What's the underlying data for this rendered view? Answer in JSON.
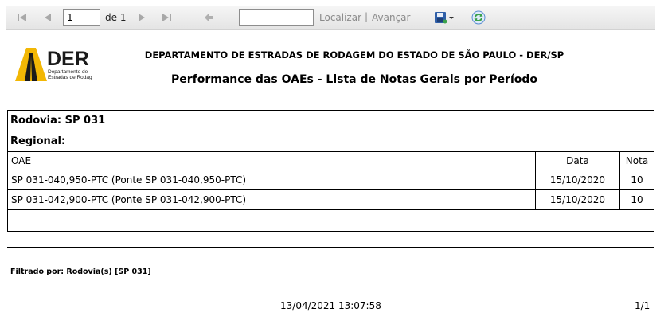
{
  "toolbar": {
    "page_current": "1",
    "page_of": "de 1",
    "find_placeholder": "",
    "find_label": "Localizar",
    "separator": "|",
    "next_label": "Avançar"
  },
  "header": {
    "logo_text": "DER",
    "logo_subtitle_1": "Departamento de",
    "logo_subtitle_2": "Estradas de Rodagem",
    "org_title": "DEPARTAMENTO DE ESTRADAS DE RODAGEM DO ESTADO DE SÃO PAULO - DER/SP",
    "report_title": "Performance das OAEs - Lista de Notas Gerais por Período"
  },
  "table": {
    "rodovia": "Rodovia: SP 031",
    "regional": "Regional:",
    "columns": [
      "OAE",
      "Data",
      "Nota"
    ],
    "rows": [
      {
        "oae": "SP 031-040,950-PTC (Ponte SP 031-040,950-PTC)",
        "data": "15/10/2020",
        "nota": "10"
      },
      {
        "oae": "SP 031-042,900-PTC (Ponte SP 031-042,900-PTC)",
        "data": "15/10/2020",
        "nota": "10"
      }
    ]
  },
  "filter": "Filtrado por: Rodovia(s) [SP 031]",
  "footer": {
    "datetime": "13/04/2021 13:07:58",
    "page": "1/1"
  },
  "colors": {
    "logo_yellow": "#f2b705",
    "logo_dark": "#1a1a1a",
    "refresh_green": "#3aa14a",
    "save_blue": "#2f5fa8"
  }
}
